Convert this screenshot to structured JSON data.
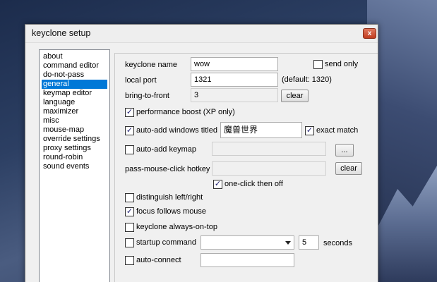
{
  "window": {
    "title": "keyclone setup",
    "close": "x"
  },
  "nav": {
    "items": [
      "about",
      "command editor",
      "do-not-pass",
      "general",
      "keymap editor",
      "language",
      "maximizer",
      "misc",
      "mouse-map",
      "override settings",
      "proxy settings",
      "round-robin",
      "sound events"
    ],
    "selected": "general"
  },
  "general": {
    "keyclone_name": {
      "label": "keyclone name",
      "value": "wow"
    },
    "send_only": {
      "label": "send only",
      "checked": false
    },
    "local_port": {
      "label": "local port",
      "value": "1321",
      "default_note": "(default: 1320)"
    },
    "bring_to_front": {
      "label": "bring-to-front",
      "value": "3",
      "clear_label": "clear"
    },
    "performance_boost": {
      "label": "performance boost (XP only)",
      "checked": true
    },
    "auto_add_windows": {
      "label": "auto-add windows titled",
      "checked": true,
      "value": "魔兽世界"
    },
    "exact_match": {
      "label": "exact match",
      "checked": true
    },
    "auto_add_keymap": {
      "label": "auto-add keymap",
      "checked": false,
      "value": "",
      "browse_label": "..."
    },
    "pass_mouse_click": {
      "label": "pass-mouse-click hotkey",
      "value": "",
      "clear_label": "clear"
    },
    "one_click_then_off": {
      "label": "one-click then off",
      "checked": true
    },
    "distinguish_left_right": {
      "label": "distinguish left/right",
      "checked": false
    },
    "focus_follows_mouse": {
      "label": "focus follows mouse",
      "checked": true
    },
    "always_on_top": {
      "label": "keyclone always-on-top",
      "checked": false
    },
    "startup_command": {
      "label": "startup command",
      "checked": false,
      "value": "",
      "delay": "5",
      "unit": "seconds"
    },
    "auto_connect": {
      "label": "auto-connect",
      "checked": false,
      "value": ""
    }
  },
  "check_mark": "✓"
}
